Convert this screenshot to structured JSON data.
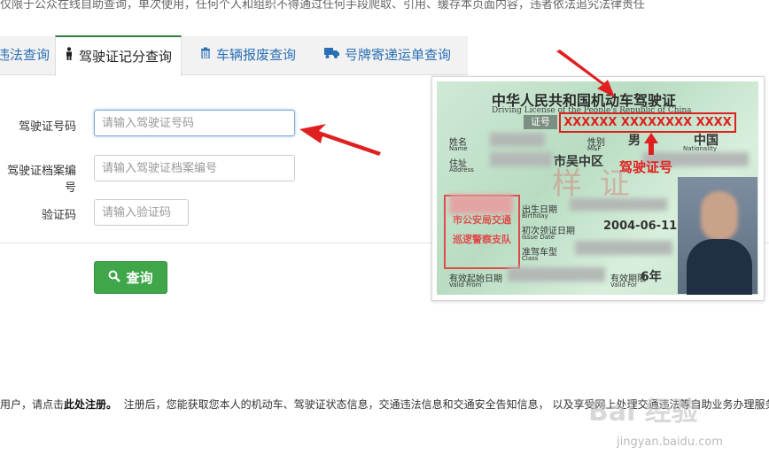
{
  "notice": "仅限于公众在线自助查询，单次使用，任何个人和组织不得通过任何手段爬取、引用、缓存本页面内容，违者依法追究法律责任",
  "tabs": [
    {
      "label": "违法查询",
      "icon": "none"
    },
    {
      "label": "驾驶证记分查询",
      "icon": "person-icon",
      "active": true
    },
    {
      "label": "车辆报废查询",
      "icon": "trash-icon"
    },
    {
      "label": "号牌寄递运单查询",
      "icon": "truck-icon"
    }
  ],
  "form": {
    "license_label": "驾驶证号码",
    "license_placeholder": "请输入驾驶证号码",
    "file_label": "驾驶证档案编号",
    "file_placeholder": "请输入驾驶证档案编号",
    "captcha_label": "验证码",
    "captcha_placeholder": "请输入验证码",
    "query_button": "查询"
  },
  "footer": {
    "prefix": "用户，请点击",
    "link": "此处注册。",
    "suffix": "注册后，您能获取您本人的机动车、驾驶证状态信息，交通违法信息和交通安全告知信息， 以及享受网上处理交通违法等自助业务办理服务"
  },
  "card": {
    "title": "中华人民共和国机动车驾驶证",
    "subtitle": "Driving License of the People's Republic of China",
    "number_label": "证号",
    "number": "XXXXXX XXXXXXXX XXXX",
    "name_label": "姓名",
    "name_en": "Name",
    "sex_label": "性别",
    "sex_value": "男",
    "sex_en": "M&F",
    "nationality_value": "中国",
    "nationality_en": "Nationality",
    "address_label": "住址",
    "address_en": "Address",
    "address_partial": "市吴中区",
    "birth_label": "出生日期",
    "birth_en": "Birthday",
    "issue_label": "初次领证日期",
    "issue_en": "Issue Date",
    "issue_value": "2004-06-11",
    "class_label": "准驾车型",
    "class_en": "Class",
    "valid_from_label": "有效起始日期",
    "valid_from_en": "Valid From",
    "valid_for_label": "有效期限",
    "valid_for_en": "Valid For",
    "valid_for_value": "6年",
    "stamp_line1": "市公安局交通",
    "stamp_line2": "巡逻警察支队",
    "watermark": "样证",
    "annotation": "驾驶证号"
  },
  "watermarks": {
    "brand": "Bai 经验",
    "url": "jingyan.baidu.com"
  },
  "colors": {
    "accent_green": "#3fa64a",
    "link_blue": "#2a6fb5",
    "annotation_red": "#e02020"
  }
}
